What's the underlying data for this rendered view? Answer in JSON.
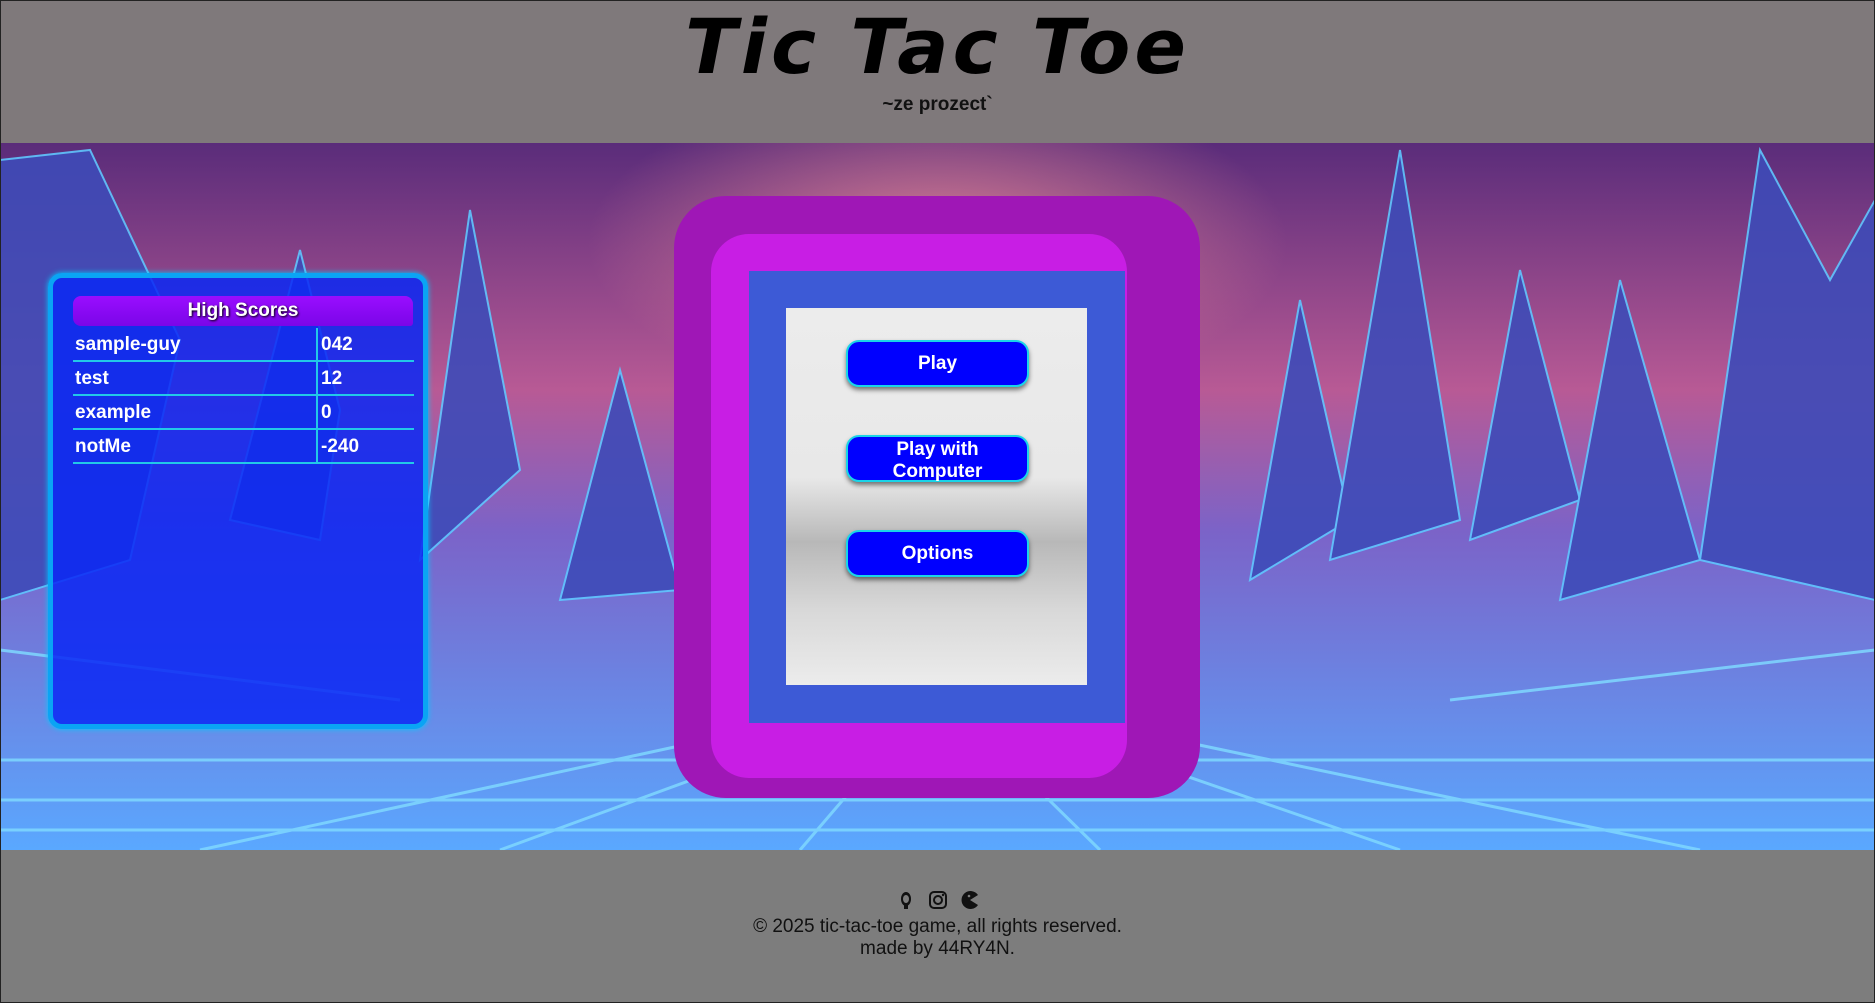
{
  "header": {
    "title": "Tic Tac Toe",
    "subtitle": "~ze prozect`"
  },
  "high_scores": {
    "heading": "High Scores",
    "rows": [
      {
        "name": "sample-guy",
        "score": "042"
      },
      {
        "name": "test",
        "score": "12"
      },
      {
        "name": "example",
        "score": "0"
      },
      {
        "name": "notMe",
        "score": "-240"
      }
    ]
  },
  "menu": {
    "play_label": "Play",
    "play_computer_line1": "Play with",
    "play_computer_line2": "Computer",
    "options_label": "Options"
  },
  "footer": {
    "social_icons": [
      "github-icon",
      "instagram-icon",
      "pacman-icon"
    ],
    "copyright": "© 2025 tic-tac-toe game, all rights reserved.",
    "credit": "made by 44RY4N."
  },
  "colors": {
    "button_blue": "#0000ff",
    "menu_magenta": "#c81ee4",
    "scores_border": "#0aa4f4",
    "scores_header_purple": "#9a0dff"
  }
}
